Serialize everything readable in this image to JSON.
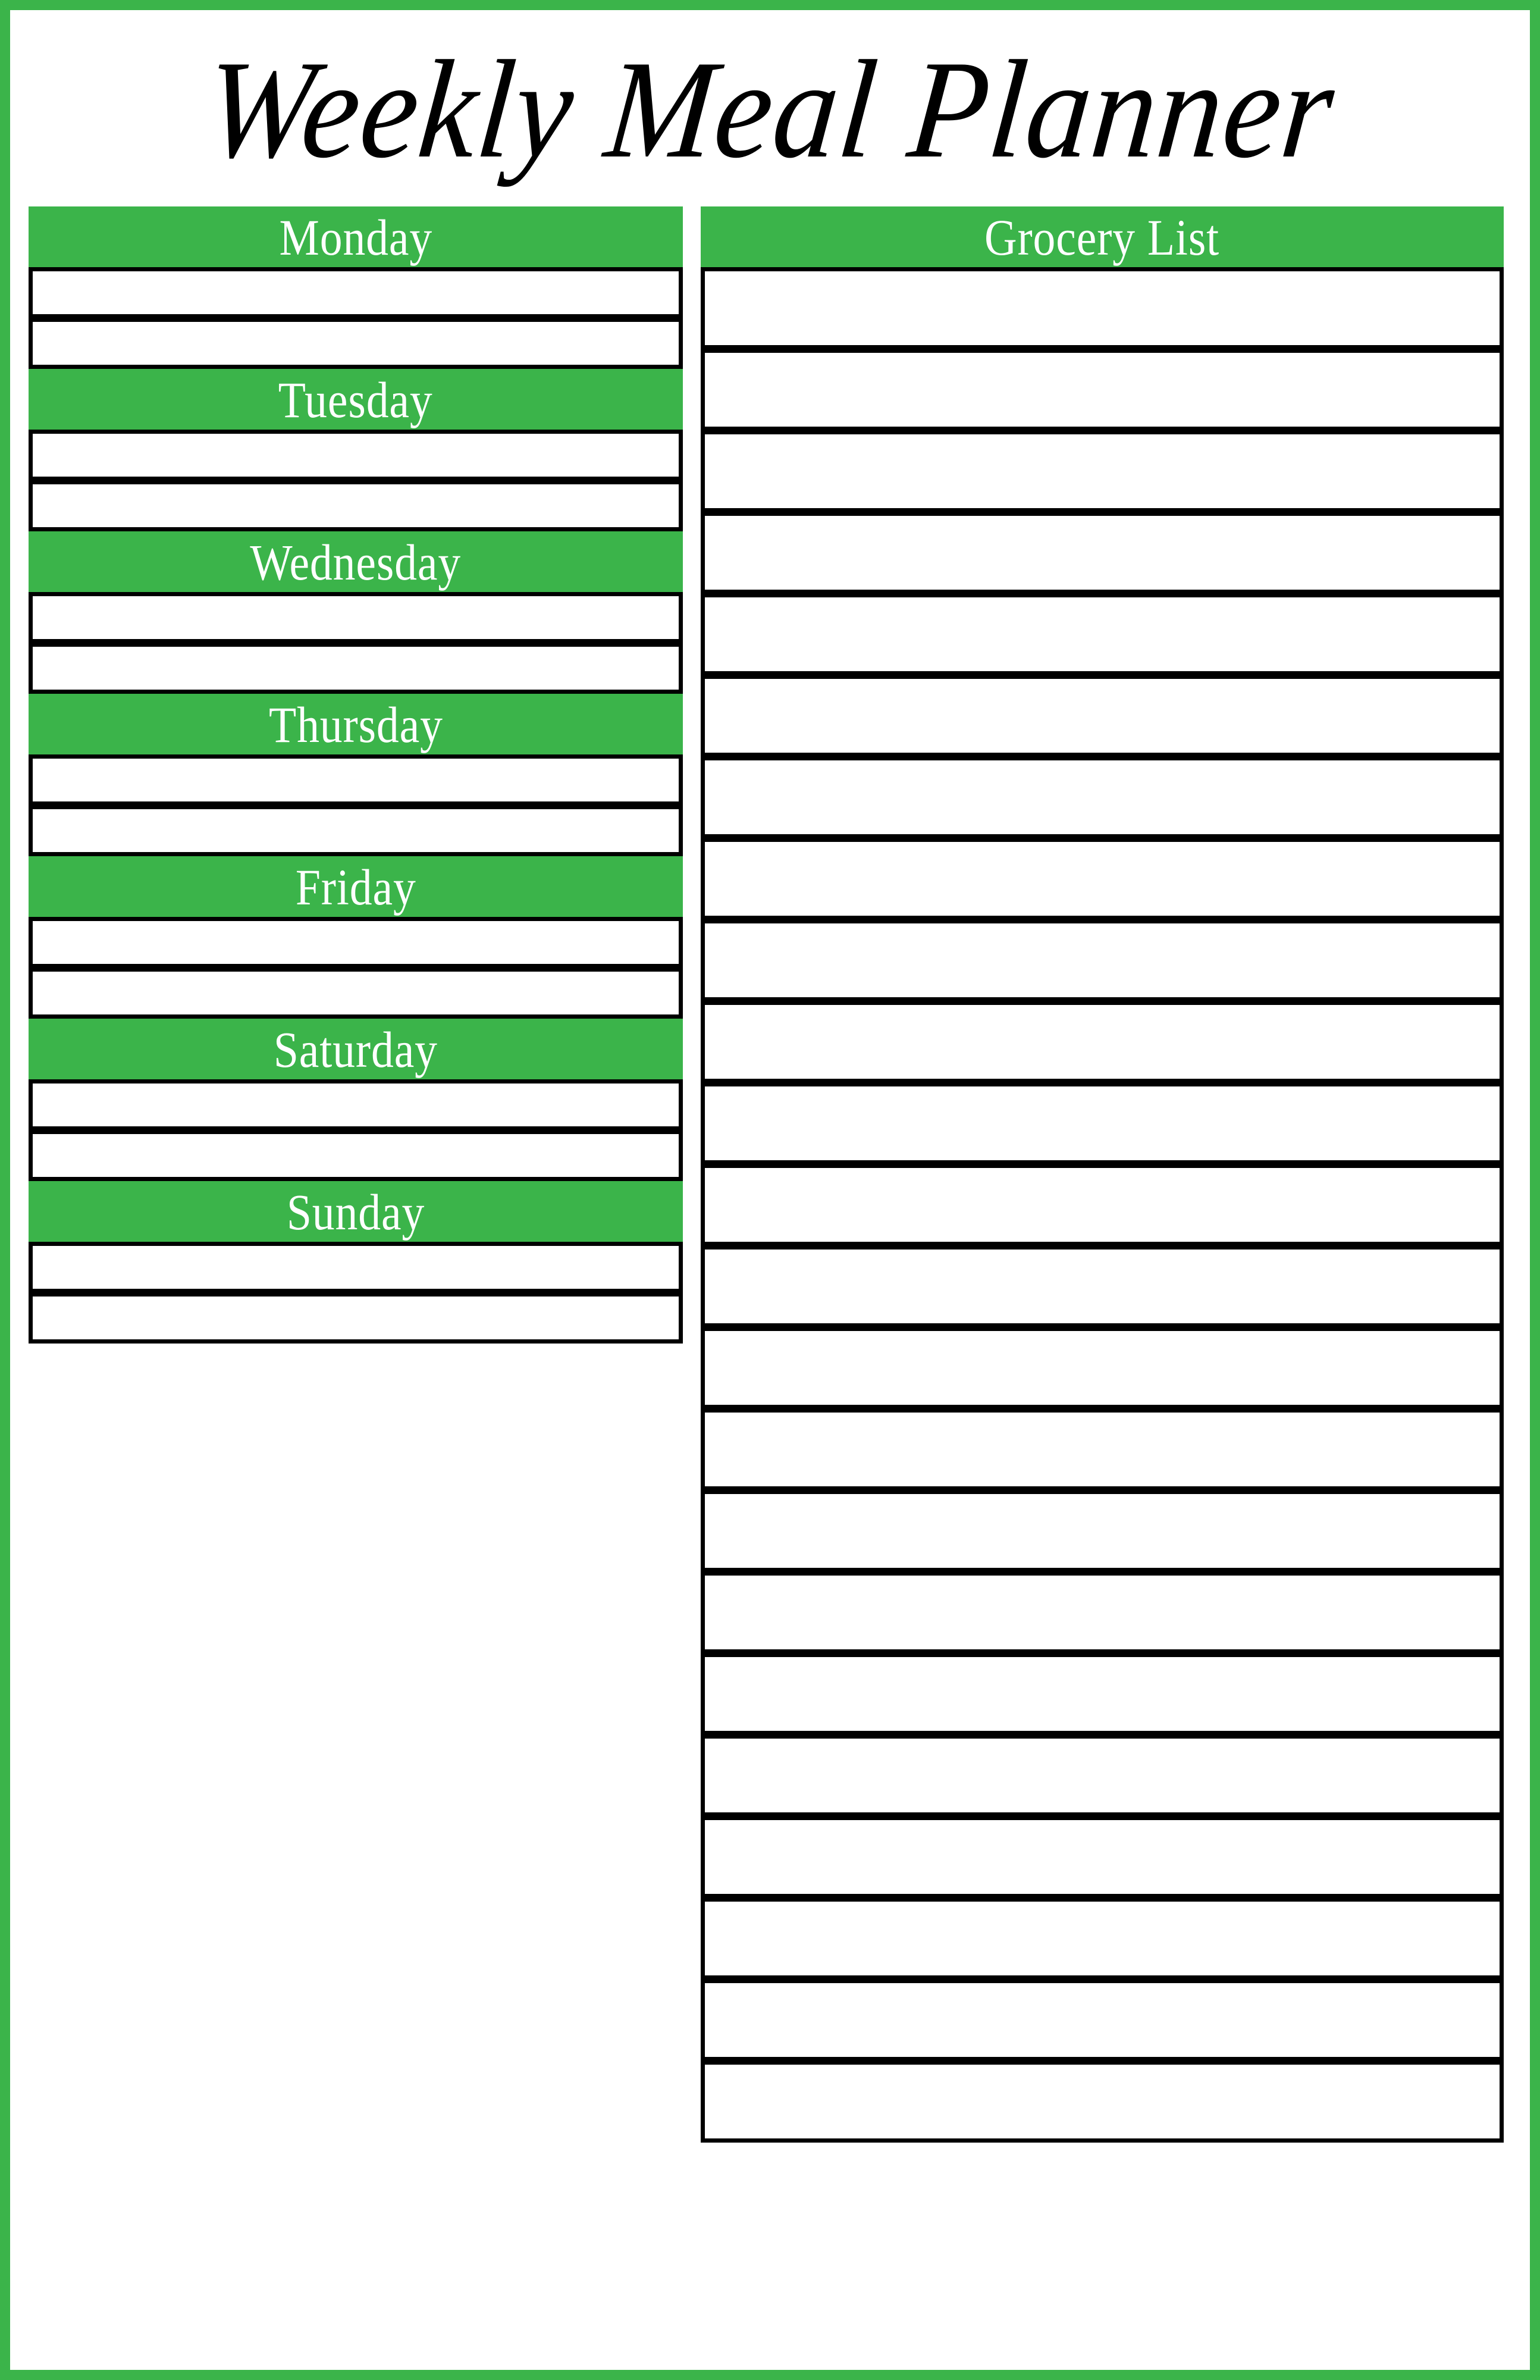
{
  "document": {
    "title": "Weekly Meal Planner",
    "accent_color": "#3bb44a",
    "border_color": "#000000",
    "header_text_color": "#ffffff"
  },
  "planner": {
    "slots_per_day": 2,
    "days": [
      {
        "label": "Monday",
        "slots": [
          "",
          ""
        ]
      },
      {
        "label": "Tuesday",
        "slots": [
          "",
          ""
        ]
      },
      {
        "label": "Wednesday",
        "slots": [
          "",
          ""
        ]
      },
      {
        "label": "Thursday",
        "slots": [
          "",
          ""
        ]
      },
      {
        "label": "Friday",
        "slots": [
          "",
          ""
        ]
      },
      {
        "label": "Saturday",
        "slots": [
          "",
          ""
        ]
      },
      {
        "label": "Sunday",
        "slots": [
          "",
          ""
        ]
      }
    ]
  },
  "grocery": {
    "header": "Grocery List",
    "line_count": 23,
    "lines": [
      "",
      "",
      "",
      "",
      "",
      "",
      "",
      "",
      "",
      "",
      "",
      "",
      "",
      "",
      "",
      "",
      "",
      "",
      "",
      "",
      "",
      "",
      ""
    ]
  }
}
